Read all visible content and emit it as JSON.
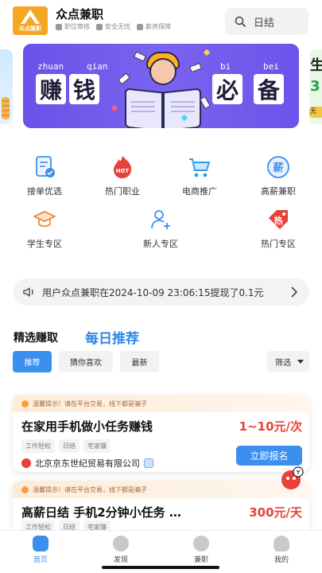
{
  "header": {
    "logo_text": "众点兼职",
    "app_name": "众点兼职",
    "badges": [
      {
        "icon": "verified-icon",
        "label": "职位审核"
      },
      {
        "icon": "shield-icon",
        "label": "安全无忧"
      },
      {
        "icon": "wallet-icon",
        "label": "薪资保障"
      }
    ],
    "search_text": "日结"
  },
  "banner": {
    "pinyin": [
      "zhuan",
      "qian",
      "bi",
      "bei"
    ],
    "chars": [
      "赚",
      "钱",
      "必",
      "备"
    ],
    "peek_right": [
      "生",
      "3",
      "无"
    ]
  },
  "categories": [
    {
      "label": "接单优选",
      "icon": "document-check-icon"
    },
    {
      "label": "热门职业",
      "icon": "hot-flame-icon"
    },
    {
      "label": "电商推广",
      "icon": "shopping-cart-icon"
    },
    {
      "label": "高薪兼职",
      "icon": "high-salary-icon"
    },
    {
      "label": "学生专区",
      "icon": "graduation-cap-icon"
    },
    {
      "label": "新人专区",
      "icon": "new-user-icon"
    },
    {
      "label": "热门专区",
      "icon": "hot-tag-icon"
    }
  ],
  "notice": {
    "text": "用户众点兼职在2024-10-09 23:06:15提现了0.1元"
  },
  "section": {
    "title": "精选赚取",
    "daily": "每日推荐"
  },
  "filters": {
    "tabs": [
      "推荐",
      "猜你喜欢",
      "最新"
    ],
    "sort_label": "筛选"
  },
  "jobs": [
    {
      "tip": "温馨提示！请在平台交易，线下都是骗子",
      "title": "在家用手机做小任务赚钱",
      "price": "1~10元/次",
      "tags": [
        "工作轻松",
        "日结",
        "宅家赚"
      ],
      "company": "北京京东世纪贸易有限公司",
      "apply_label": "立即报名"
    },
    {
      "tip": "温馨提示！请在平台交易，线下都是骗子",
      "title": "高薪日结 手机2分钟小任务 …",
      "price": "300元/天",
      "tags": [
        "工作轻松",
        "日结",
        "宅家赚"
      ]
    }
  ],
  "bottom_nav": [
    {
      "label": "首页",
      "icon": "home-icon",
      "active": true
    },
    {
      "label": "发现",
      "icon": "discover-icon",
      "active": false
    },
    {
      "label": "兼职",
      "icon": "parttime-icon",
      "active": false
    },
    {
      "label": "我的",
      "icon": "profile-icon",
      "active": false
    }
  ],
  "colors": {
    "accent": "#3a8ff0",
    "price": "#e8413a",
    "banner": "#6a52e8",
    "logo": "#f5a623"
  }
}
